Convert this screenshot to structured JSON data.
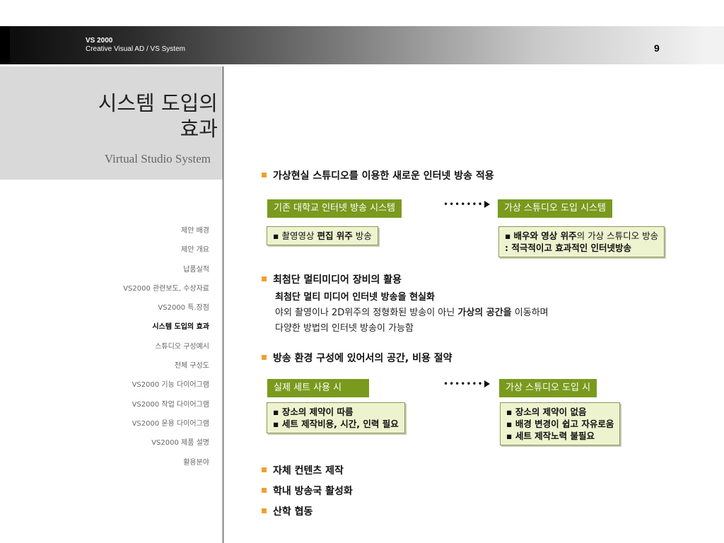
{
  "header": {
    "brand_line1": "VS 2000",
    "brand_line2": "Creative Visual AD / VS System",
    "page_number": "9"
  },
  "sidebar": {
    "title_line1": "시스템 도입의",
    "title_line2": "효과",
    "subtitle": "Virtual Studio System",
    "nav": [
      "제안 배경",
      "제안 개요",
      "납품실적",
      "VS2000 관련보도, 수상자료",
      "VS2000 특.장점",
      "시스템 도입의 효과",
      "스튜디오 구성예시",
      "전체 구성도",
      "VS2000 기능 다이어그램",
      "VS2000 작업 다이어그램",
      "VS2000 운용 다이어그램",
      "VS2000 제품 설명",
      "활용분야"
    ],
    "active_index": 5
  },
  "content": {
    "s1": {
      "heading": "가상현실 스튜디오를 이용한 새로운 인터넷 방송 적용",
      "left_label": "기존 대학교 인터넷 방송 시스템",
      "right_label": "가상 스튜디오 도입 시스템",
      "left_box": {
        "a": "촬영영상 ",
        "b": "편집 위주",
        "c": " 방송"
      },
      "right_box": {
        "a": "배우와 영상 위주",
        "b": "의 가상 스튜디오 방송",
        "line2": ": 적극적이고 효과적인 인터넷방송"
      }
    },
    "s2": {
      "heading": "최첨단 멀티미디어 장비의 활용",
      "line1": "최첨단 멀티 미디어 인터넷 방송을 현실화",
      "line2_a": "야외 촬영이나 2D위주의 정형화된 방송이 아닌 ",
      "line2_b": "가상의 공간을",
      "line2_c": " 이동하며",
      "line3": "다양한 방법의 인터넷 방송이 가능함"
    },
    "s3": {
      "heading": "방송 환경 구성에 있어서의 공간, 비용 절약",
      "left_label": "실제 세트 사용 시",
      "right_label": "가상 스튜디오 도입 시",
      "left_items": [
        "장소의 제약이 따름",
        "세트 제작비용, 시간, 인력 필요"
      ],
      "right_items": [
        "장소의 제약이 없음",
        "배경 변경이 쉽고 자유로움",
        "세트 제작노력 불필요"
      ]
    },
    "bullets_bottom": [
      "자체 컨텐츠 제작",
      "학내 방송국 활성화",
      "산학 협동"
    ],
    "bullet_square": "■",
    "colors": {
      "accent_orange": "#f0a030",
      "green_label": "#7a9a1e",
      "note_box": "#eef3cf"
    }
  }
}
